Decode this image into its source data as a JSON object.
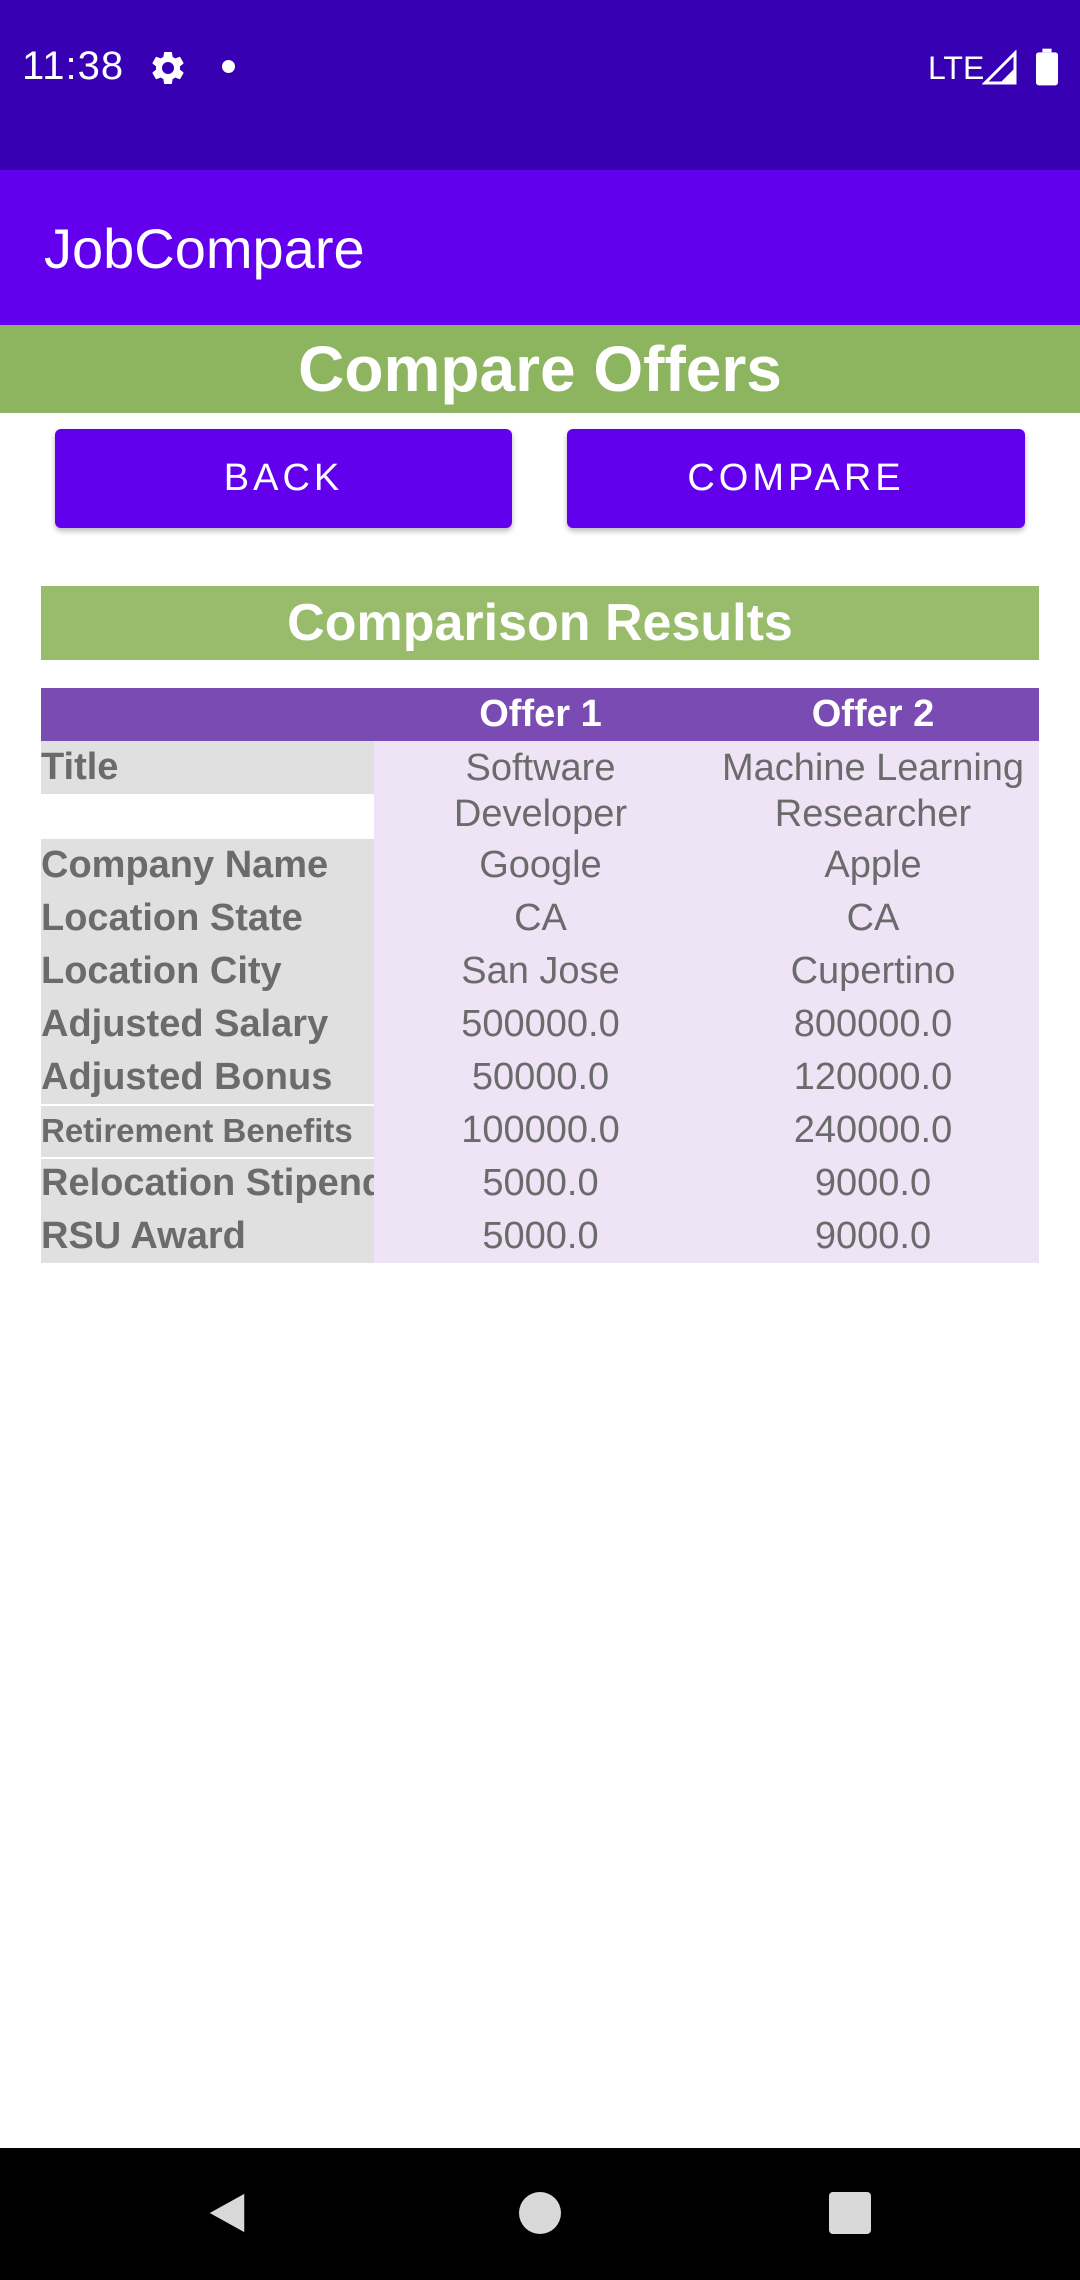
{
  "status_bar": {
    "time": "11:38",
    "network": "LTE",
    "icons": [
      "gear-icon",
      "notification-dot-icon",
      "signal-icon",
      "battery-icon"
    ]
  },
  "app_bar": {
    "title": "JobCompare"
  },
  "screen": {
    "heading": "Compare Offers",
    "back_label": "BACK",
    "compare_label": "COMPARE"
  },
  "results": {
    "heading": "Comparison Results",
    "columns": [
      "",
      "Offer 1",
      "Offer 2"
    ],
    "rows": [
      {
        "label": "Title",
        "offer1": "Software Developer",
        "offer2": "Machine Learning Researcher"
      },
      {
        "label": "Company Name",
        "offer1": "Google",
        "offer2": "Apple"
      },
      {
        "label": "Location State",
        "offer1": "CA",
        "offer2": "CA"
      },
      {
        "label": "Location City",
        "offer1": "San Jose",
        "offer2": "Cupertino"
      },
      {
        "label": "Adjusted Salary",
        "offer1": "500000.0",
        "offer2": "800000.0"
      },
      {
        "label": "Adjusted Bonus",
        "offer1": "50000.0",
        "offer2": "120000.0"
      },
      {
        "label": "Retirement Benefits",
        "offer1": "100000.0",
        "offer2": "240000.0"
      },
      {
        "label": "Relocation Stipend",
        "offer1": "5000.0",
        "offer2": "9000.0"
      },
      {
        "label": "RSU Award",
        "offer1": "5000.0",
        "offer2": "9000.0"
      }
    ]
  },
  "colors": {
    "status_bar": "#3700b3",
    "app_bar": "#6200ee",
    "heading_green": "#8db55f",
    "results_green": "#99bc6c",
    "table_header": "#7b4bb4",
    "label_bg": "#e0e0e0",
    "value_bg": "#efe4f5"
  },
  "nav_bar": {
    "icons": [
      "back-triangle-icon",
      "home-circle-icon",
      "recents-square-icon"
    ]
  }
}
